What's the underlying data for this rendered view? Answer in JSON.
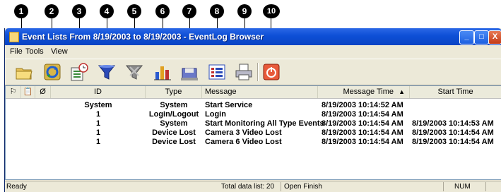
{
  "callouts": [
    "1",
    "2",
    "3",
    "4",
    "5",
    "6",
    "7",
    "8",
    "9",
    "10"
  ],
  "window": {
    "title": "Event Lists From 8/19/2003 to 8/19/2003 - EventLog Browser",
    "buttons": {
      "minimize": "_",
      "maximize": "□",
      "close": "X"
    }
  },
  "menu": {
    "file": "File",
    "tools": "Tools",
    "view": "View"
  },
  "toolbar": [
    {
      "name": "open-folder-icon"
    },
    {
      "name": "refresh-icon"
    },
    {
      "name": "schedule-icon"
    },
    {
      "name": "filter-icon"
    },
    {
      "name": "clear-filter-icon"
    },
    {
      "name": "chart-icon"
    },
    {
      "name": "save-icon"
    },
    {
      "name": "list-view-icon"
    },
    {
      "name": "print-icon"
    },
    {
      "name": "power-icon"
    }
  ],
  "columns": {
    "flag": "⚐",
    "note": "📋",
    "attach": "Ø",
    "id": "ID",
    "type": "Type",
    "message": "Message",
    "message_time": "Message Time",
    "sort_indicator": "▲",
    "start_time": "Start Time"
  },
  "rows": [
    {
      "id": "System",
      "type": "System",
      "message": "Start Service",
      "message_time": "8/19/2003 10:14:52 AM",
      "start_time": ""
    },
    {
      "id": "1",
      "type": "Login/Logout",
      "message": "Login",
      "message_time": "8/19/2003 10:14:54 AM",
      "start_time": ""
    },
    {
      "id": "1",
      "type": "System",
      "message": "Start Monitoring All Type Events",
      "message_time": "8/19/2003 10:14:54 AM",
      "start_time": "8/19/2003 10:14:53 AM"
    },
    {
      "id": "1",
      "type": "Device Lost",
      "message": "Camera 3 Video Lost",
      "message_time": "8/19/2003 10:14:54 AM",
      "start_time": "8/19/2003 10:14:54 AM"
    },
    {
      "id": "1",
      "type": "Device Lost",
      "message": "Camera 6 Video Lost",
      "message_time": "8/19/2003 10:14:54 AM",
      "start_time": "8/19/2003 10:14:54 AM"
    }
  ],
  "status": {
    "ready": "Ready",
    "total": "Total data list: 20",
    "state": "Open Finish",
    "num": "NUM"
  }
}
